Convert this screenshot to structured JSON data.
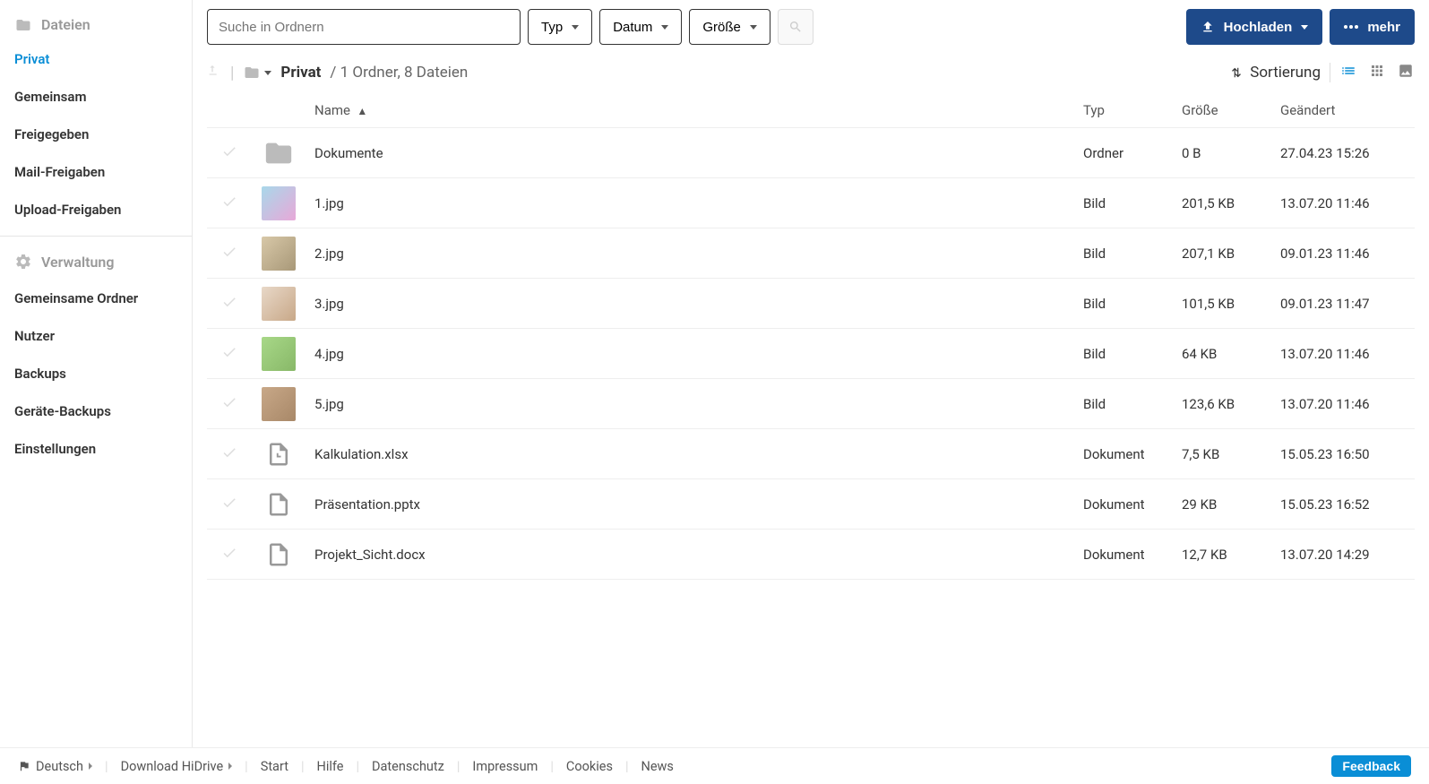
{
  "sidebar": {
    "files_header": "Dateien",
    "items": [
      {
        "label": "Privat",
        "active": true
      },
      {
        "label": "Gemeinsam"
      },
      {
        "label": "Freigegeben"
      },
      {
        "label": "Mail-Freigaben"
      },
      {
        "label": "Upload-Freigaben"
      }
    ],
    "admin_header": "Verwaltung",
    "admin_items": [
      {
        "label": "Gemeinsame Ordner"
      },
      {
        "label": "Nutzer"
      },
      {
        "label": "Backups"
      },
      {
        "label": "Geräte-Backups"
      },
      {
        "label": "Einstellungen"
      }
    ]
  },
  "toolbar": {
    "search_placeholder": "Suche in Ordnern",
    "filter_type": "Typ",
    "filter_date": "Datum",
    "filter_size": "Größe",
    "upload_label": "Hochladen",
    "more_label": "mehr"
  },
  "breadcrumb": {
    "current": "Privat",
    "count": "/ 1 Ordner, 8 Dateien",
    "sort_label": "Sortierung"
  },
  "table": {
    "headers": {
      "name": "Name",
      "type": "Typ",
      "size": "Größe",
      "modified": "Geändert"
    },
    "rows": [
      {
        "name": "Dokumente",
        "type": "Ordner",
        "size": "0 B",
        "modified": "27.04.23 15:26",
        "thumb": "folder"
      },
      {
        "name": "1.jpg",
        "type": "Bild",
        "size": "201,5 KB",
        "modified": "13.07.20 11:46",
        "thumb": "img1"
      },
      {
        "name": "2.jpg",
        "type": "Bild",
        "size": "207,1 KB",
        "modified": "09.01.23 11:46",
        "thumb": "img2"
      },
      {
        "name": "3.jpg",
        "type": "Bild",
        "size": "101,5 KB",
        "modified": "09.01.23 11:47",
        "thumb": "img3"
      },
      {
        "name": "4.jpg",
        "type": "Bild",
        "size": "64 KB",
        "modified": "13.07.20 11:46",
        "thumb": "img4"
      },
      {
        "name": "5.jpg",
        "type": "Bild",
        "size": "123,6 KB",
        "modified": "13.07.20 11:46",
        "thumb": "img5"
      },
      {
        "name": "Kalkulation.xlsx",
        "type": "Dokument",
        "size": "7,5 KB",
        "modified": "15.05.23 16:50",
        "thumb": "xlsx"
      },
      {
        "name": "Präsentation.pptx",
        "type": "Dokument",
        "size": "29 KB",
        "modified": "15.05.23 16:52",
        "thumb": "pptx"
      },
      {
        "name": "Projekt_Sicht.docx",
        "type": "Dokument",
        "size": "12,7 KB",
        "modified": "13.07.20 14:29",
        "thumb": "docx"
      }
    ]
  },
  "footer": {
    "language": "Deutsch",
    "download": "Download HiDrive",
    "links": [
      "Start",
      "Hilfe",
      "Datenschutz",
      "Impressum",
      "Cookies",
      "News"
    ],
    "feedback": "Feedback"
  }
}
